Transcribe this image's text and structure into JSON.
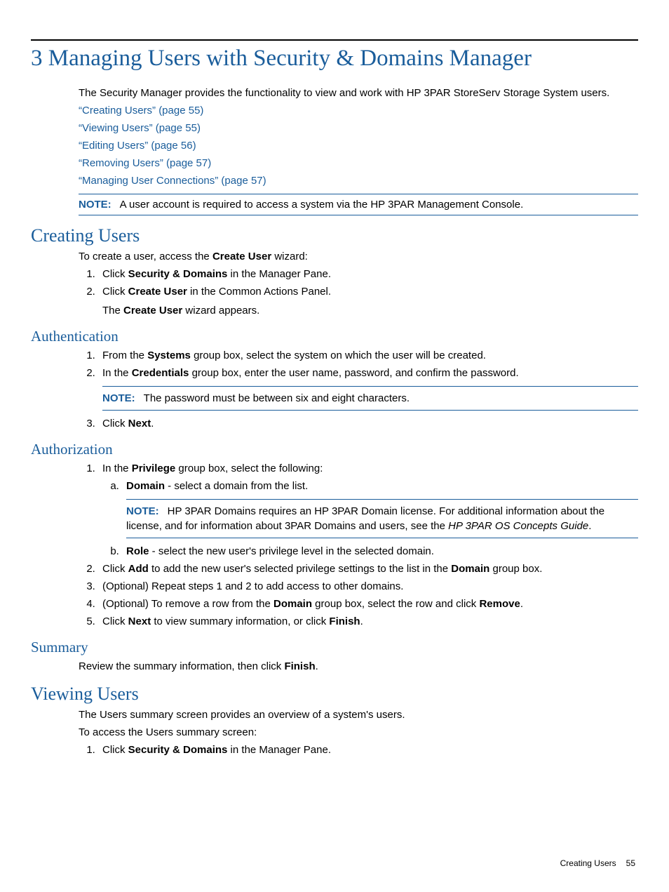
{
  "chapter_title": "3 Managing Users with Security & Domains Manager",
  "intro": "The Security Manager provides the functionality to view and work with HP 3PAR StoreServ Storage System users.",
  "links": [
    "“Creating Users” (page 55)",
    "“Viewing Users” (page 55)",
    "“Editing Users” (page 56)",
    "“Removing Users” (page 57)",
    "“Managing User Connections” (page 57)"
  ],
  "note_label": "NOTE:",
  "note1": "A user account is required to access a system via the HP 3PAR Management Console.",
  "creating": {
    "title": "Creating Users",
    "intro_pre": "To create a user, access the ",
    "intro_bold": "Create User",
    "intro_post": " wizard:",
    "s1_pre": "Click ",
    "s1_bold": "Security & Domains",
    "s1_post": " in the Manager Pane.",
    "s2_pre": "Click ",
    "s2_bold": "Create User",
    "s2_post": " in the Common Actions Panel.",
    "s2_sub_pre": "The ",
    "s2_sub_bold": "Create User",
    "s2_sub_post": " wizard appears."
  },
  "auth": {
    "title": "Authentication",
    "s1_pre": "From the ",
    "s1_bold": "Systems",
    "s1_post": " group box, select the system on which the user will be created.",
    "s2_pre": "In the ",
    "s2_bold": "Credentials",
    "s2_post": " group box, enter the user name, password, and confirm the password.",
    "note": "The password must be between six and eight characters.",
    "s3_pre": "Click ",
    "s3_bold": "Next",
    "s3_post": "."
  },
  "authz": {
    "title": "Authorization",
    "s1_pre": "In the ",
    "s1_bold": "Privilege",
    "s1_post": " group box, select the following:",
    "a_bold": "Domain",
    "a_post": " - select a domain from the list.",
    "note_pre": "HP 3PAR Domains requires an HP 3PAR Domain license. For additional information about the license, and for information about 3PAR Domains and users, see the ",
    "note_italic": "HP 3PAR OS Concepts Guide",
    "note_post": ".",
    "b_bold": "Role",
    "b_post": " - select the new user's privilege level in the selected domain.",
    "s2_pre": "Click ",
    "s2_bold": "Add",
    "s2_mid": " to add the new user's selected privilege settings to the list in the ",
    "s2_bold2": "Domain",
    "s2_post": " group box.",
    "s3": "(Optional) Repeat steps 1 and 2 to add access to other domains.",
    "s4_pre": "(Optional) To remove a row from the ",
    "s4_bold": "Domain",
    "s4_mid": " group box, select the row and click ",
    "s4_bold2": "Remove",
    "s4_post": ".",
    "s5_pre": "Click ",
    "s5_bold": "Next",
    "s5_mid": " to view summary information, or click ",
    "s5_bold2": "Finish",
    "s5_post": "."
  },
  "summary": {
    "title": "Summary",
    "text_pre": "Review the summary information, then click ",
    "text_bold": "Finish",
    "text_post": "."
  },
  "viewing": {
    "title": "Viewing Users",
    "p1": "The Users summary screen provides an overview of a system's users.",
    "p2": "To access the Users summary screen:",
    "s1_pre": "Click ",
    "s1_bold": "Security & Domains",
    "s1_post": " in the Manager Pane."
  },
  "footer": {
    "section": "Creating Users",
    "page": "55"
  }
}
